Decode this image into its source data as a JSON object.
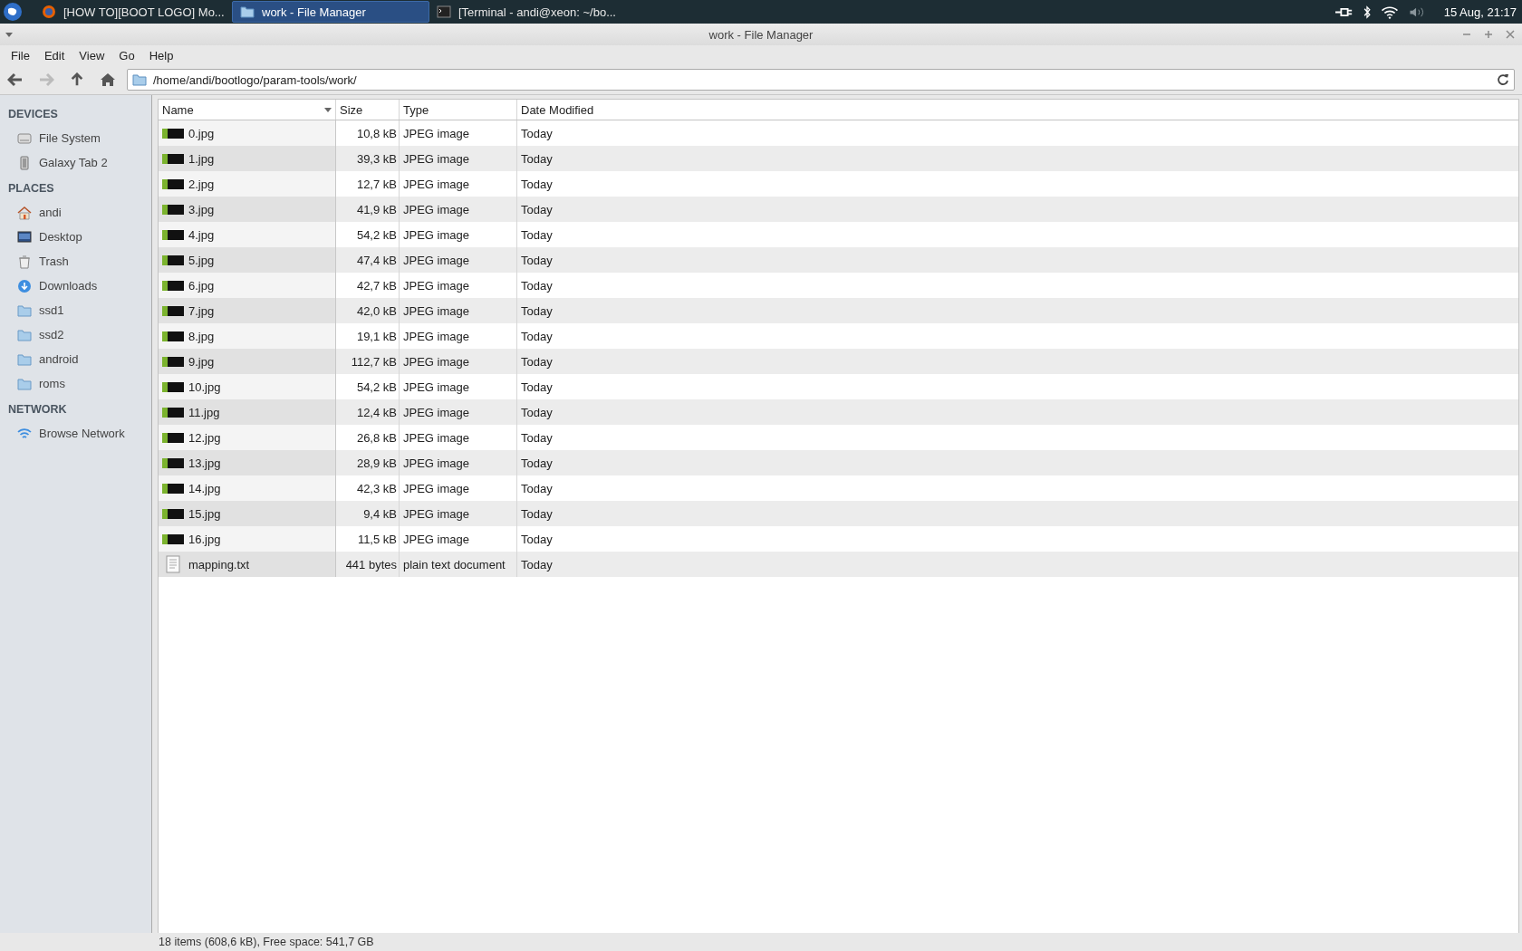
{
  "taskbar": {
    "tasks": [
      {
        "kind": "browser",
        "label": "[HOW TO][BOOT LOGO] Mo...",
        "selected": false
      },
      {
        "kind": "folder",
        "label": "work - File Manager",
        "selected": true
      },
      {
        "kind": "terminal",
        "label": "[Terminal - andi@xeon: ~/bo...",
        "selected": false
      }
    ],
    "clock": "15 Aug, 21:17"
  },
  "window": {
    "title": "work - File Manager"
  },
  "menu": [
    "File",
    "Edit",
    "View",
    "Go",
    "Help"
  ],
  "location": {
    "value": "/home/andi/bootlogo/param-tools/work/"
  },
  "sidebar": [
    {
      "heading": "DEVICES",
      "items": [
        {
          "kind": "drive",
          "label": "File System"
        },
        {
          "kind": "device",
          "label": "Galaxy Tab 2"
        }
      ]
    },
    {
      "heading": "PLACES",
      "items": [
        {
          "kind": "home",
          "label": "andi"
        },
        {
          "kind": "desktop",
          "label": "Desktop"
        },
        {
          "kind": "trash",
          "label": "Trash"
        },
        {
          "kind": "download",
          "label": "Downloads"
        },
        {
          "kind": "folder",
          "label": "ssd1"
        },
        {
          "kind": "folder",
          "label": "ssd2"
        },
        {
          "kind": "folder",
          "label": "android"
        },
        {
          "kind": "folder",
          "label": "roms"
        }
      ]
    },
    {
      "heading": "NETWORK",
      "items": [
        {
          "kind": "network",
          "label": "Browse Network"
        }
      ]
    }
  ],
  "table": {
    "columns": [
      {
        "label": "Name",
        "sorted": true
      },
      {
        "label": "Size",
        "sorted": false
      },
      {
        "label": "Type",
        "sorted": false
      },
      {
        "label": "Date Modified",
        "sorted": false
      }
    ],
    "rows": [
      {
        "kind": "image",
        "name": "0.jpg",
        "size": "10,8 kB",
        "type": "JPEG image",
        "modified": "Today"
      },
      {
        "kind": "image",
        "name": "1.jpg",
        "size": "39,3 kB",
        "type": "JPEG image",
        "modified": "Today"
      },
      {
        "kind": "image",
        "name": "2.jpg",
        "size": "12,7 kB",
        "type": "JPEG image",
        "modified": "Today"
      },
      {
        "kind": "image",
        "name": "3.jpg",
        "size": "41,9 kB",
        "type": "JPEG image",
        "modified": "Today"
      },
      {
        "kind": "image",
        "name": "4.jpg",
        "size": "54,2 kB",
        "type": "JPEG image",
        "modified": "Today"
      },
      {
        "kind": "image",
        "name": "5.jpg",
        "size": "47,4 kB",
        "type": "JPEG image",
        "modified": "Today"
      },
      {
        "kind": "image",
        "name": "6.jpg",
        "size": "42,7 kB",
        "type": "JPEG image",
        "modified": "Today"
      },
      {
        "kind": "image",
        "name": "7.jpg",
        "size": "42,0 kB",
        "type": "JPEG image",
        "modified": "Today"
      },
      {
        "kind": "image",
        "name": "8.jpg",
        "size": "19,1 kB",
        "type": "JPEG image",
        "modified": "Today"
      },
      {
        "kind": "image",
        "name": "9.jpg",
        "size": "112,7 kB",
        "type": "JPEG image",
        "modified": "Today"
      },
      {
        "kind": "image",
        "name": "10.jpg",
        "size": "54,2 kB",
        "type": "JPEG image",
        "modified": "Today"
      },
      {
        "kind": "image",
        "name": "11.jpg",
        "size": "12,4 kB",
        "type": "JPEG image",
        "modified": "Today"
      },
      {
        "kind": "image",
        "name": "12.jpg",
        "size": "26,8 kB",
        "type": "JPEG image",
        "modified": "Today"
      },
      {
        "kind": "image",
        "name": "13.jpg",
        "size": "28,9 kB",
        "type": "JPEG image",
        "modified": "Today"
      },
      {
        "kind": "image",
        "name": "14.jpg",
        "size": "42,3 kB",
        "type": "JPEG image",
        "modified": "Today"
      },
      {
        "kind": "image",
        "name": "15.jpg",
        "size": "9,4 kB",
        "type": "JPEG image",
        "modified": "Today"
      },
      {
        "kind": "image",
        "name": "16.jpg",
        "size": "11,5 kB",
        "type": "JPEG image",
        "modified": "Today"
      },
      {
        "kind": "text",
        "name": "mapping.txt",
        "size": "441 bytes",
        "type": "plain text document",
        "modified": "Today"
      }
    ]
  },
  "status_bar": "18 items (608,6 kB), Free space: 541,7 GB"
}
